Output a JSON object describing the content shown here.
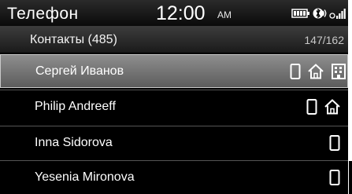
{
  "status_bar": {
    "app_title": "Телефон",
    "time": "12:00",
    "period": "AM",
    "icons": [
      "battery-icon",
      "bluetooth-icon",
      "signal-icon"
    ]
  },
  "contacts": {
    "title": "Контакты (485)",
    "position": "147/162",
    "items": [
      {
        "name": "Сергей Иванов",
        "selected": true,
        "numbers": [
          "mobile-phone-icon",
          "home-icon",
          "office-icon"
        ]
      },
      {
        "name": "Philip Andreeff",
        "selected": false,
        "numbers": [
          "mobile-phone-icon",
          "home-icon"
        ]
      },
      {
        "name": "Inna Sidorova",
        "selected": false,
        "numbers": [
          "mobile-phone-icon"
        ]
      },
      {
        "name": "Yesenia Mironova",
        "selected": false,
        "numbers": [
          "mobile-phone-icon"
        ]
      }
    ]
  },
  "colors": {
    "background": "#000000",
    "selected_row": "#7a7a7a",
    "text": "#ffffff",
    "dim_text": "#c8c8c8"
  }
}
